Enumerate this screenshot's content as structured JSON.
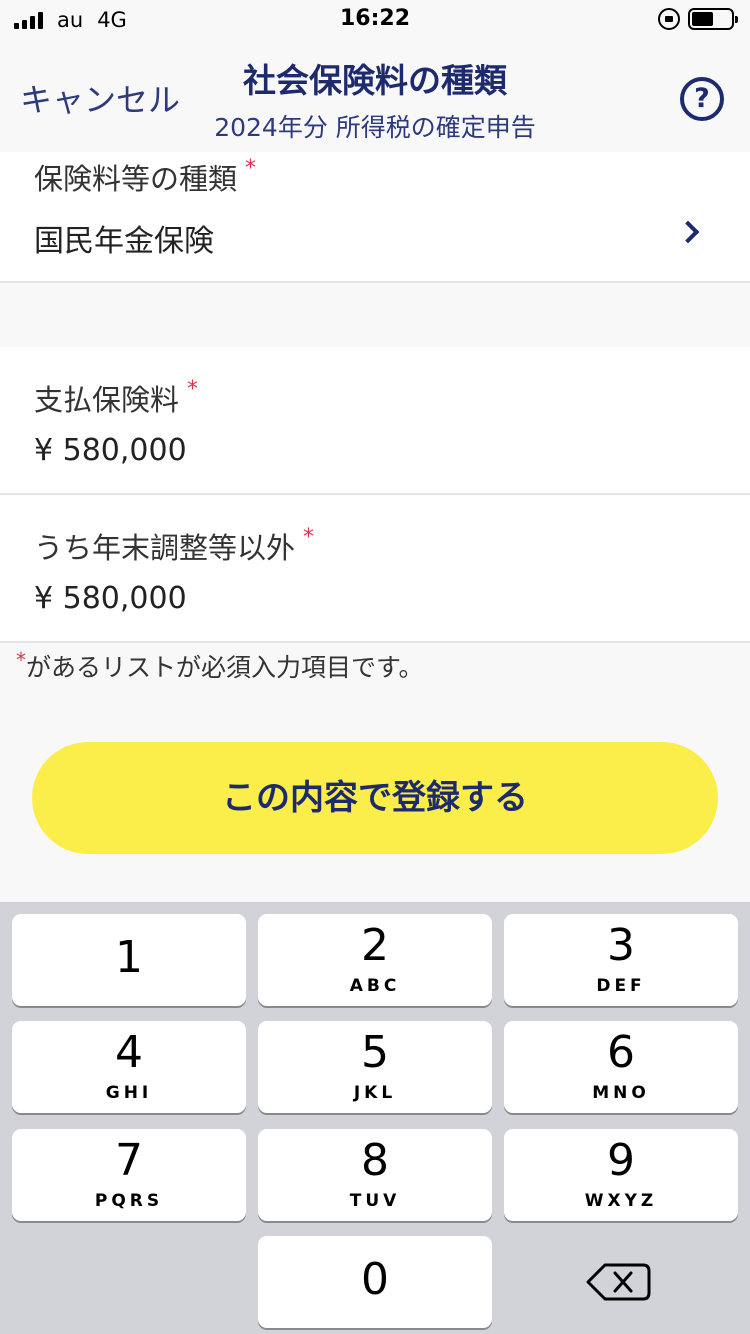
{
  "status_bar": {
    "carrier": "au",
    "network": "4G",
    "time": "16:22"
  },
  "nav": {
    "cancel_label": "キャンセル",
    "title": "社会保険料の種類",
    "subtitle": "2024年分 所得税の確定申告",
    "help_glyph": "?"
  },
  "fields": {
    "insurance_type": {
      "label": "保険料等の種類",
      "required_mark": "*",
      "value": "国民年金保険"
    },
    "paid_premium": {
      "label": "支払保険料",
      "required_mark": "*",
      "value": "¥ 580,000"
    },
    "excluding_year_end": {
      "label": "うち年末調整等以外",
      "required_mark": "*",
      "value": "¥ 580,000"
    }
  },
  "note": {
    "star": "*",
    "text": "があるリストが必須入力項目です。"
  },
  "submit_label": "この内容で登録する",
  "keypad": {
    "keys": [
      {
        "num": "1",
        "letters": ""
      },
      {
        "num": "2",
        "letters": "ABC"
      },
      {
        "num": "3",
        "letters": "DEF"
      },
      {
        "num": "4",
        "letters": "GHI"
      },
      {
        "num": "5",
        "letters": "JKL"
      },
      {
        "num": "6",
        "letters": "MNO"
      },
      {
        "num": "7",
        "letters": "PQRS"
      },
      {
        "num": "8",
        "letters": "TUV"
      },
      {
        "num": "9",
        "letters": "WXYZ"
      },
      {
        "num": "0",
        "letters": ""
      }
    ],
    "delete_icon": "backspace-icon"
  },
  "colors": {
    "accent": "#1e2a6e",
    "button": "#fbee4a",
    "required": "#e0334a",
    "keypad_bg": "#d1d3d9"
  }
}
